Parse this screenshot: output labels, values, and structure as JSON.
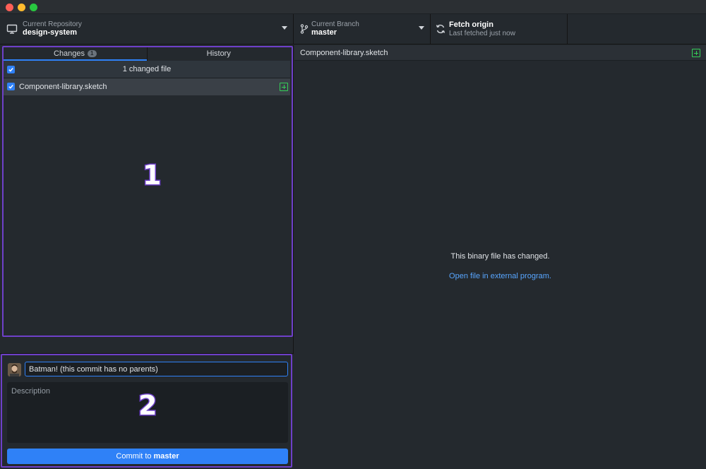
{
  "toolbar": {
    "repo_label": "Current Repository",
    "repo_name": "design-system",
    "branch_label": "Current Branch",
    "branch_name": "master",
    "fetch_title": "Fetch origin",
    "fetch_status": "Last fetched just now"
  },
  "tabs": {
    "changes_label": "Changes",
    "changes_count": "1",
    "history_label": "History"
  },
  "changes": {
    "header": "1 changed file",
    "files": [
      {
        "name": "Component-library.sketch",
        "status": "added",
        "checked": true
      }
    ]
  },
  "annotations": {
    "one": "1",
    "two": "2"
  },
  "commit": {
    "summary_value": "Batman! (this commit has no parents)",
    "description_placeholder": "Description",
    "button_prefix": "Commit to",
    "button_branch": "master"
  },
  "diff": {
    "file_name": "Component-library.sketch",
    "message": "This binary file has changed.",
    "link": "Open file in external program."
  },
  "colors": {
    "accent": "#2f81f7",
    "annotation": "#6e40c9",
    "added": "#34d058",
    "link": "#58a6ff"
  },
  "icons": [
    "computer-icon",
    "branch-icon",
    "sync-icon",
    "caret-down-icon",
    "checkbox-icon",
    "file-added-icon",
    "avatar"
  ]
}
